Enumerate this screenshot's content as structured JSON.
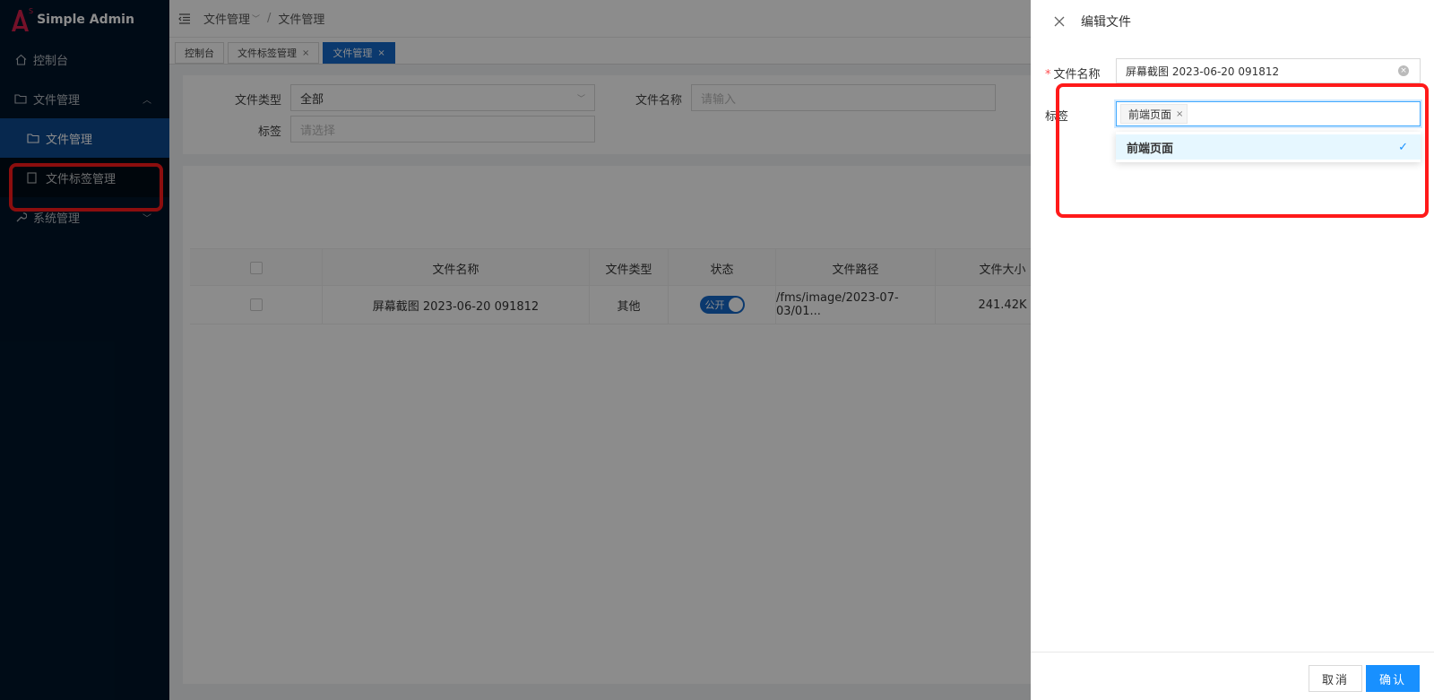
{
  "app": {
    "title": "Simple Admin",
    "logo_sup": "S"
  },
  "sidebar": {
    "items": [
      {
        "label": "控制台",
        "icon": "home-icon"
      },
      {
        "label": "文件管理",
        "icon": "folder-icon",
        "expanded": true
      },
      {
        "label": "文件管理",
        "icon": "folder-icon",
        "sub": true,
        "active": true
      },
      {
        "label": "文件标签管理",
        "icon": "book-icon",
        "sub": true
      },
      {
        "label": "系统管理",
        "icon": "wrench-icon"
      }
    ]
  },
  "header": {
    "breadcrumb": [
      "文件管理",
      "文件管理"
    ],
    "sep": "/"
  },
  "tabs": [
    {
      "label": "控制台",
      "closable": false
    },
    {
      "label": "文件标签管理",
      "closable": true
    },
    {
      "label": "文件管理",
      "closable": true,
      "active": true
    }
  ],
  "filters": {
    "file_type_label": "文件类型",
    "file_type_value": "全部",
    "file_name_label": "文件名称",
    "file_name_placeholder": "请输入",
    "tag_label": "标签",
    "tag_placeholder": "请选择"
  },
  "table": {
    "columns": [
      "文件名称",
      "文件类型",
      "状态",
      "文件路径",
      "文件大小"
    ],
    "rows": [
      {
        "name": "屏幕截图 2023-06-20 091812",
        "type": "其他",
        "status": "公开",
        "path": "/fms/image/2023-07-03/01...",
        "size": "241.42K"
      }
    ]
  },
  "drawer": {
    "title": "编辑文件",
    "name_label": "文件名称",
    "name_value": "屏幕截图 2023-06-20 091812",
    "tag_label": "标签",
    "selected_tags": [
      "前端页面"
    ],
    "options": [
      {
        "label": "前端页面",
        "selected": true
      }
    ],
    "cancel": "取消",
    "confirm": "确认"
  },
  "colors": {
    "sidebar_bg": "#001529",
    "accent": "#1469c8",
    "primary": "#1890ff",
    "highlight": "#ff1a1a"
  }
}
